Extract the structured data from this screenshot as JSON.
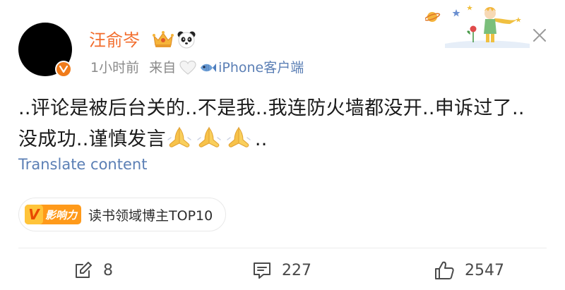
{
  "post": {
    "author": {
      "name": "汪俞岑",
      "verified_mark": "V",
      "badges": [
        "crown-icon",
        "panda-icon"
      ]
    },
    "time_label": "1小时前",
    "source_prefix": "来自",
    "source_client": "iPhone客户端",
    "content_lines": [
      "..评论是被后台关的..不是我..我连防火墙都没开..申诉过了..",
      "没成功..谨慎发言"
    ],
    "content_emoji": "folded-hands-icon",
    "content_tail": "..",
    "translate_label": "Translate content",
    "influence": {
      "logo_mark": "V",
      "logo_text": "影响力",
      "label": "读书领域博主TOP10"
    }
  },
  "actions": {
    "repost_count": "8",
    "comment_count": "227",
    "like_count": "2547"
  },
  "colors": {
    "username": "#f26b2a",
    "link": "#5b7fb5",
    "meta": "#8a8a8a",
    "verified": "#f07b1a"
  }
}
